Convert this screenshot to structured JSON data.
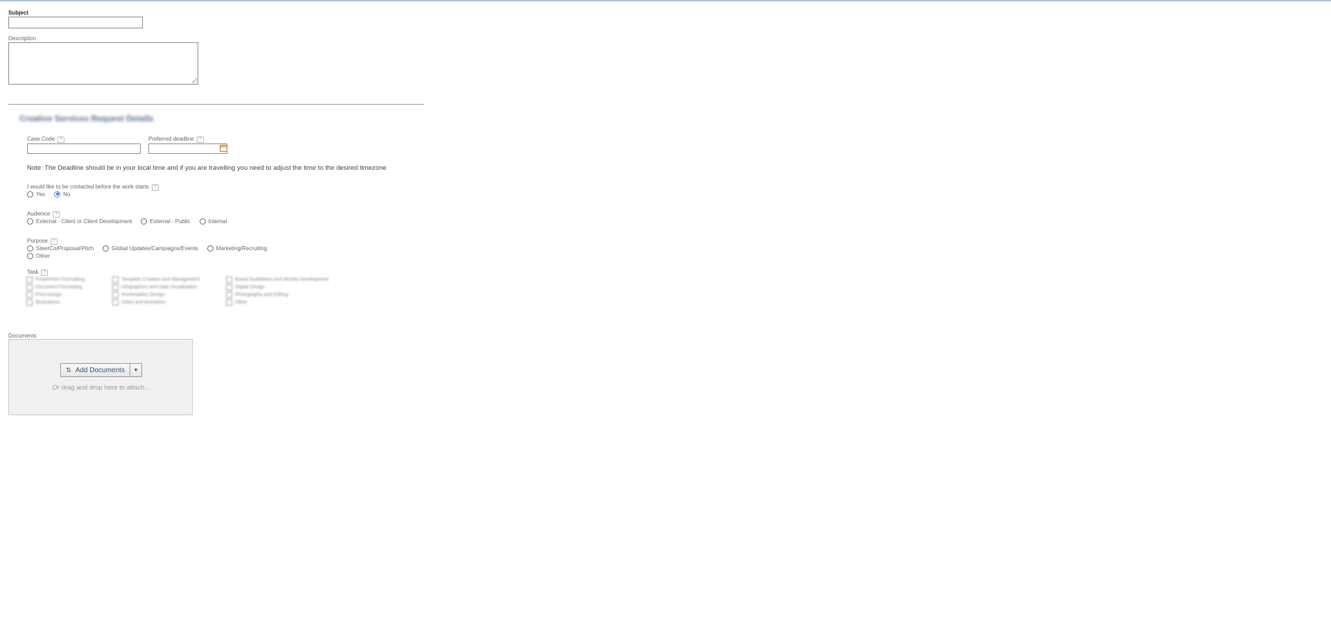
{
  "form": {
    "subject_label": "Subject",
    "subject_value": "",
    "description_label": "Description",
    "description_value": ""
  },
  "section": {
    "title": "Creative Services Request Details"
  },
  "case_code": {
    "label": "Case Code",
    "help": "?",
    "value": ""
  },
  "deadline": {
    "label": "Preferred deadline",
    "help": "?",
    "value": "",
    "icon": "calendar-icon"
  },
  "note": "Note: The Deadline should be in your local time and if you are travelling you need to adjust the time to the desired timezone",
  "contact": {
    "label": "I would like to be contacted before the work starts",
    "help": "?",
    "options": [
      "Yes",
      "No"
    ],
    "selected": "No"
  },
  "audience": {
    "label": "Audience",
    "help": "?",
    "options": [
      "External - Client or Client Development",
      "External - Public",
      "Internal"
    ]
  },
  "purpose": {
    "label": "Purpose",
    "help": "?",
    "options": [
      "SteerCo/Proposal/Pitch",
      "Global Updates/Campaigns/Events",
      "Marketing/Recruiting",
      "Other"
    ]
  },
  "task": {
    "label": "Task",
    "help": "?",
    "items": [
      "PowerPoint Formatting",
      "Document Formatting",
      "Print Design",
      "Illustrations",
      "Template Creation and Management",
      "Infographics and Data Visualization",
      "Presentation Design",
      "Video and Animation",
      "Brand Guidelines and Identity Development",
      "Digital Design",
      "Photography and Editing",
      "Other"
    ]
  },
  "documents": {
    "label": "Documents",
    "add_button": "Add Documents",
    "add_icon": "attach-icon",
    "caret_icon": "chevron-down-icon",
    "drop_hint": "Or drag and drop here to attach..."
  },
  "colors": {
    "accent": "#3b7bd8",
    "top_border": "#a9c0e0",
    "button_text": "#3b4f7a"
  }
}
